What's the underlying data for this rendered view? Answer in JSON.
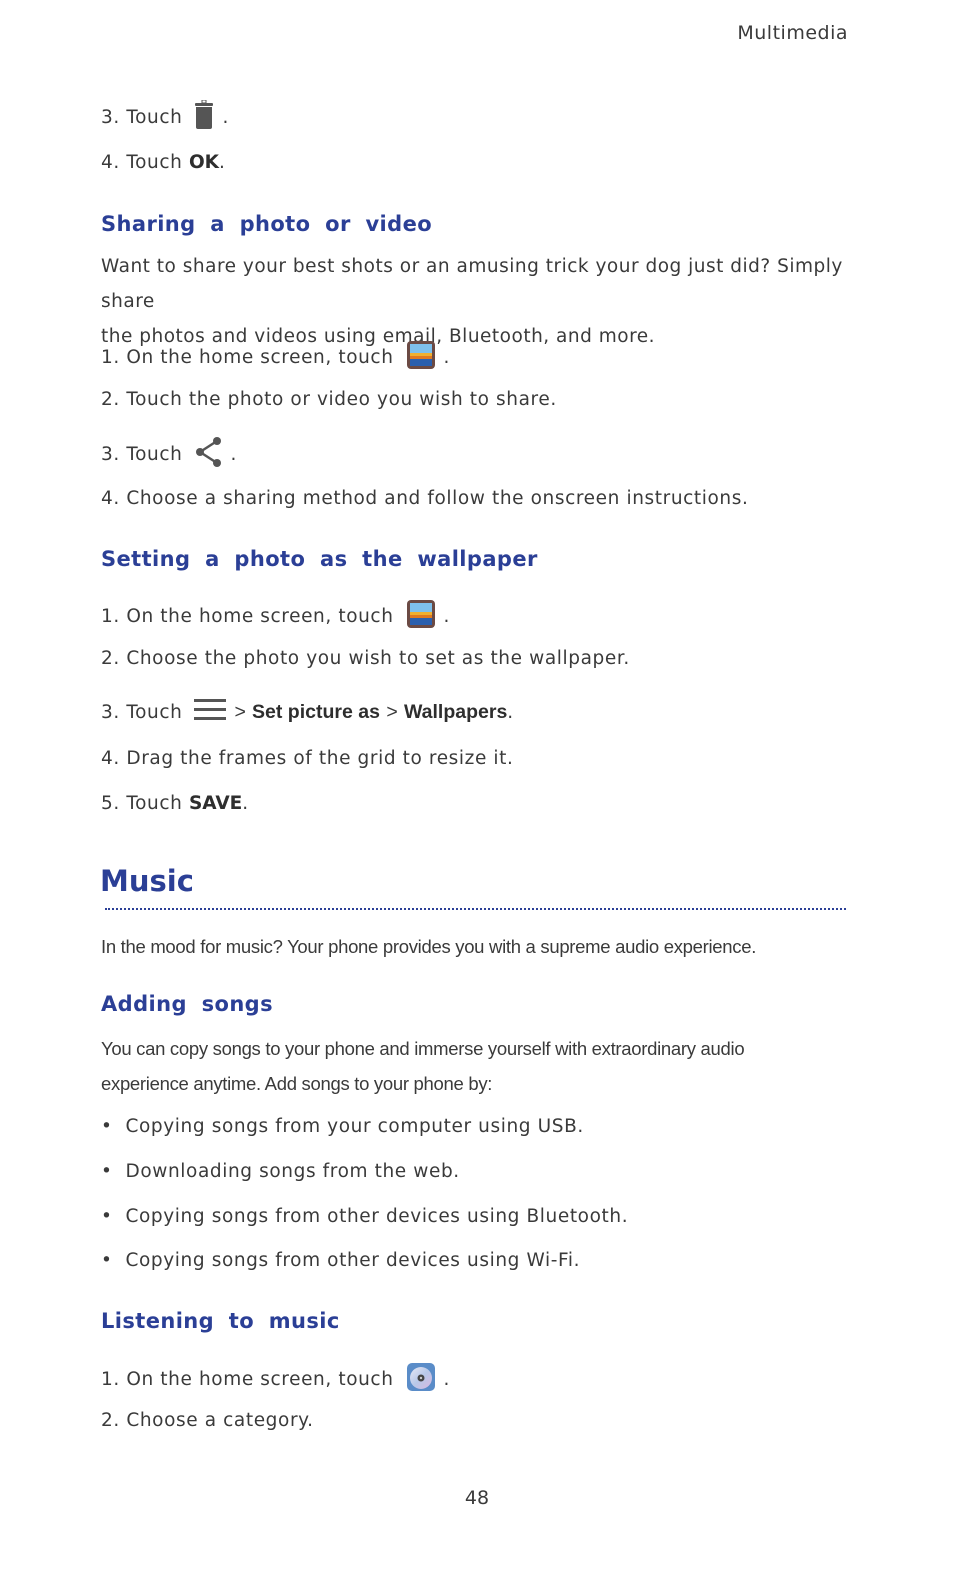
{
  "header": {
    "section": "Multimedia"
  },
  "delete_steps": [
    {
      "num": "3.",
      "pre": "Touch",
      "icon": "trash-icon",
      "post": "."
    },
    {
      "num": "4.",
      "pre": "Touch",
      "bold": "OK",
      "post": "."
    }
  ],
  "sharing": {
    "heading": "Sharing a photo or video",
    "intro_1": "Want to share your best shots or an amusing trick your dog just did? Simply share",
    "intro_2": "the photos and videos using email, Bluetooth, and more.",
    "steps": [
      {
        "num": "1.",
        "pre": "On the home screen, touch",
        "icon": "gallery-icon",
        "post": "."
      },
      {
        "num": "2.",
        "text": "Touch the photo or video you wish to share."
      },
      {
        "num": "3.",
        "pre": "Touch",
        "icon": "share-icon",
        "post": "."
      },
      {
        "num": "4.",
        "text": "Choose a sharing method and follow the onscreen instructions."
      }
    ]
  },
  "wallpaper": {
    "heading": "Setting a photo as the wallpaper",
    "steps": [
      {
        "num": "1.",
        "pre": "On the home screen, touch",
        "icon": "gallery-icon",
        "post": "."
      },
      {
        "num": "2.",
        "text": "Choose the photo you wish to set as the wallpaper."
      },
      {
        "num": "3.",
        "pre": "Touch",
        "icon": "menu-icon",
        "sep1": ">",
        "bold1": "Set picture as",
        "sep2": ">",
        "bold2": "Wallpapers",
        "post": "."
      },
      {
        "num": "4.",
        "text": "Drag the frames of the grid to resize it."
      },
      {
        "num": "5.",
        "pre": "Touch",
        "bold": "SAVE",
        "post": "."
      }
    ]
  },
  "music": {
    "title": "Music",
    "intro": "In the mood for music? Your phone provides you with a supreme audio experience.",
    "adding": {
      "heading": "Adding songs",
      "intro_1": "You can copy songs to your phone and immerse yourself with extraordinary audio",
      "intro_2": "experience anytime. Add songs to your phone by:",
      "bullets": [
        "Copying songs from your computer using USB.",
        "Downloading songs from the web.",
        "Copying songs from other devices using Bluetooth.",
        "Copying songs from other devices using Wi-Fi."
      ],
      "bullet_char": "•"
    },
    "listening": {
      "heading": "Listening to music",
      "steps": [
        {
          "num": "1.",
          "pre": "On the home screen, touch",
          "icon": "music-app-icon",
          "post": "."
        },
        {
          "num": "2.",
          "text": "Choose a category."
        }
      ]
    }
  },
  "footer": {
    "page_number": "48"
  },
  "colors": {
    "heading": "#2b3f96",
    "body_text": "#3a3a3a"
  }
}
